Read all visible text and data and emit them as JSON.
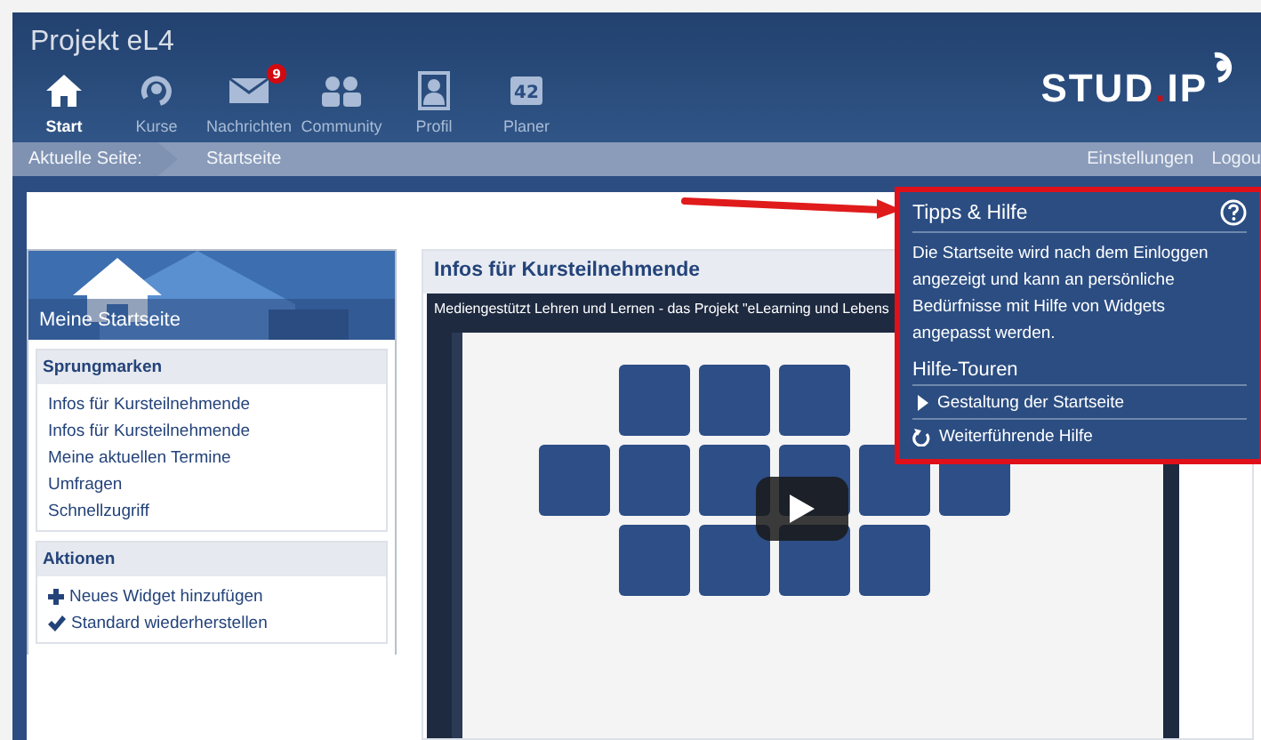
{
  "header": {
    "title": "Projekt eL4",
    "logo": {
      "left": "STUD",
      "dot": ".",
      "right": "IP"
    }
  },
  "nav": [
    {
      "label": "Start",
      "kind": "house",
      "selected": true
    },
    {
      "label": "Kurse",
      "kind": "ring",
      "selected": false
    },
    {
      "label": "Nachrichten",
      "kind": "mail",
      "selected": false,
      "badge": "9"
    },
    {
      "label": "Community",
      "kind": "people",
      "selected": false
    },
    {
      "label": "Profil",
      "kind": "person",
      "selected": false
    },
    {
      "label": "Planer",
      "kind": "calendar",
      "selected": false,
      "icon_text": "42"
    }
  ],
  "breadcrumb": {
    "label": "Aktuelle Seite:",
    "page": "Startseite",
    "links": [
      "Einstellungen",
      "Logou"
    ]
  },
  "sidebar": {
    "title": "Meine Startseite",
    "sections": [
      {
        "title": "Sprungmarken",
        "items": [
          {
            "label": "Infos für Kursteilnehmende"
          },
          {
            "label": "Infos für Kursteilnehmende"
          },
          {
            "label": "Meine aktuellen Termine"
          },
          {
            "label": "Umfragen"
          },
          {
            "label": "Schnellzugriff"
          }
        ]
      },
      {
        "title": "Aktionen",
        "items": [
          {
            "label": "Neues Widget hinzufügen",
            "kind": "plus"
          },
          {
            "label": "Standard wiederherstellen",
            "kind": "check"
          }
        ]
      }
    ]
  },
  "widget": {
    "title": "Infos für Kursteilnehmende",
    "video": {
      "kind": "picture",
      "title": "Mediengestützt Lehren und Lernen - das Projekt \"eLearning und Lebens"
    }
  },
  "help": {
    "title": "Tipps & Hilfe",
    "text": "Die Startseite wird nach dem Einloggen angezeigt und kann an persönliche Bedürfnisse mit Hilfe von Widgets angepasst werden.",
    "tours_heading": "Hilfe-Touren",
    "tours": [
      "Gestaltung der Startseite"
    ],
    "more": "Weiterführende Hilfe"
  }
}
